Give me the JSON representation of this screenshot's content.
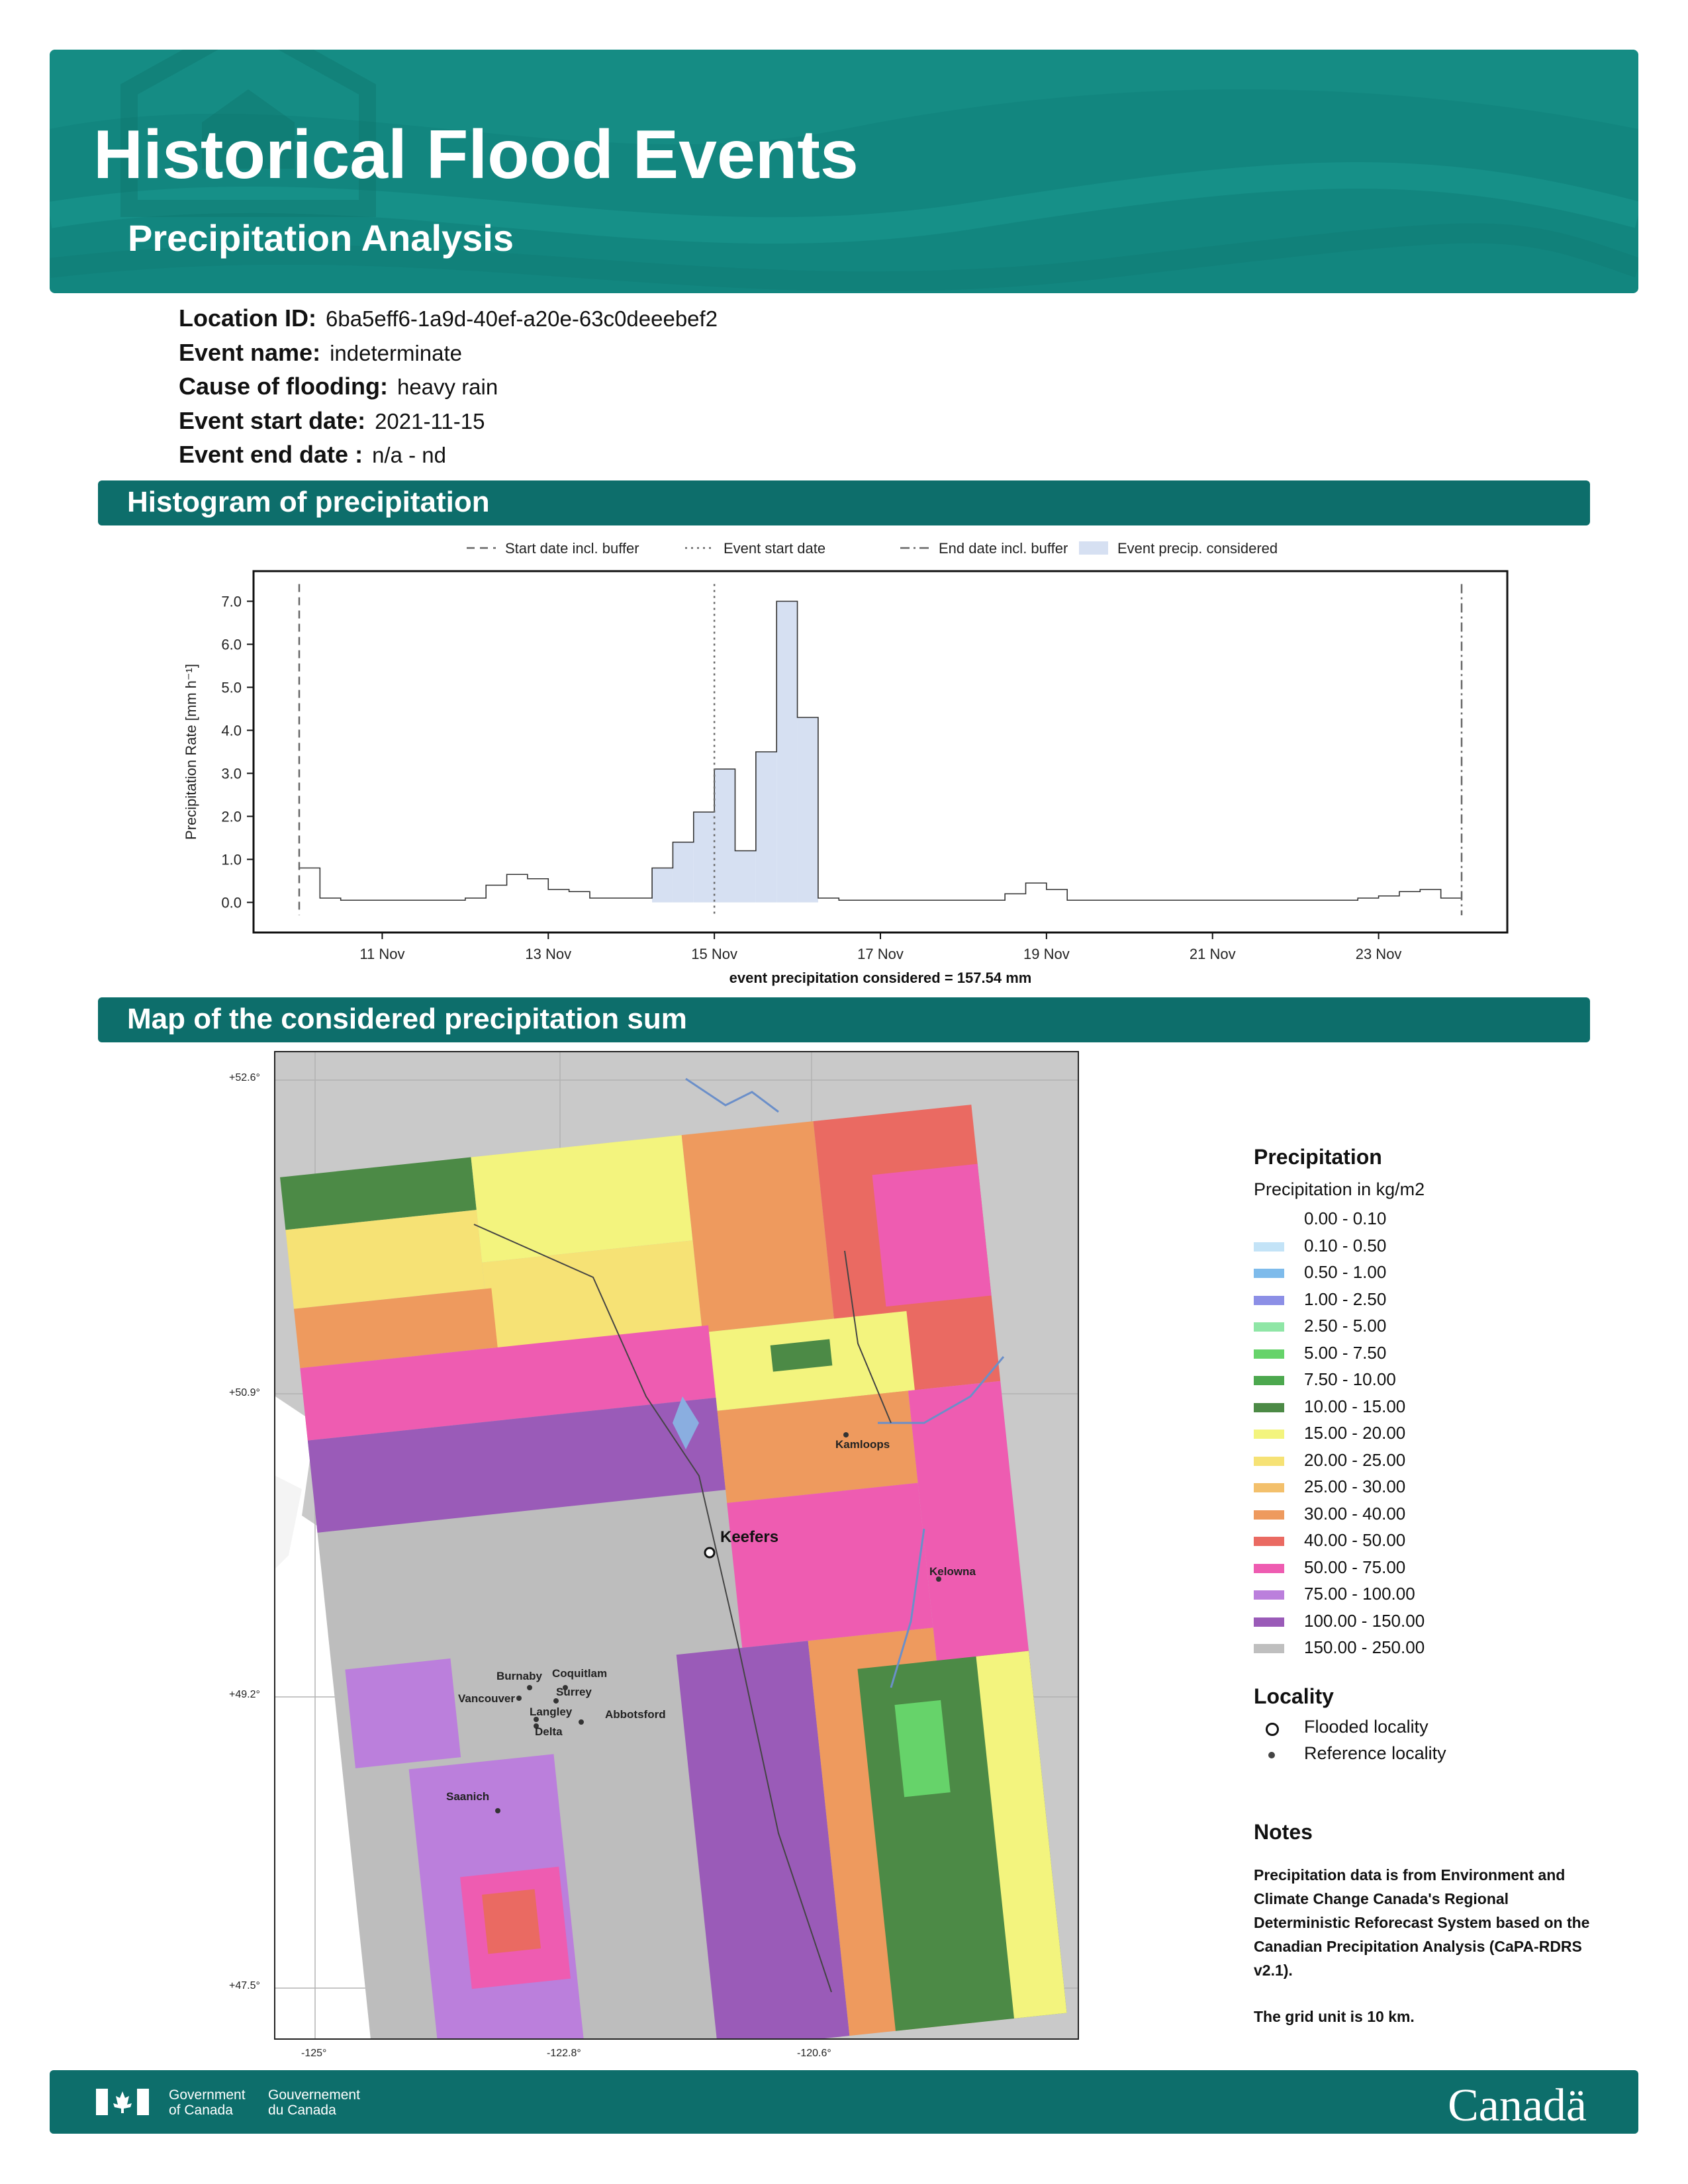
{
  "header": {
    "title": "Historical Flood Events",
    "subtitle": "Precipitation Analysis"
  },
  "event_info": [
    {
      "key": "Location ID:",
      "value": "6ba5eff6-1a9d-40ef-a20e-63c0deeebef2"
    },
    {
      "key": "Event name:",
      "value": "indeterminate"
    },
    {
      "key": "Cause of flooding:",
      "value": "heavy rain"
    },
    {
      "key": "Event start date:",
      "value": "2021-11-15"
    },
    {
      "key": "Event end date :",
      "value": "n/a - nd"
    }
  ],
  "sections": {
    "histogram": "Histogram of precipitation",
    "map": "Map of the considered precipitation sum"
  },
  "chart_data": {
    "type": "bar",
    "ylabel": "Precipitation Rate [mm h⁻¹]",
    "xlabel": "event precipitation considered = 157.54 mm",
    "ylim": [
      -0.7,
      7.7
    ],
    "yticks": [
      "0.0",
      "1.0",
      "2.0",
      "3.0",
      "4.0",
      "5.0",
      "6.0",
      "7.0"
    ],
    "xticks": [
      "11 Nov",
      "13 Nov",
      "15 Nov",
      "17 Nov",
      "19 Nov",
      "21 Nov",
      "23 Nov"
    ],
    "xtick_days": [
      11,
      13,
      15,
      17,
      19,
      21,
      23
    ],
    "x_start_day": 10,
    "bin_days": 0.25,
    "values": [
      0.8,
      0.1,
      0.05,
      0.05,
      0.05,
      0.05,
      0.05,
      0.05,
      0.1,
      0.4,
      0.65,
      0.55,
      0.3,
      0.25,
      0.1,
      0.1,
      0.1,
      0.8,
      1.4,
      2.1,
      3.1,
      1.2,
      3.5,
      7.0,
      4.3,
      0.1,
      0.05,
      0.05,
      0.05,
      0.05,
      0.05,
      0.05,
      0.05,
      0.05,
      0.2,
      0.45,
      0.3,
      0.05,
      0.05,
      0.05,
      0.05,
      0.05,
      0.05,
      0.05,
      0.05,
      0.05,
      0.05,
      0.05,
      0.05,
      0.05,
      0.05,
      0.1,
      0.15,
      0.25,
      0.3,
      0.1
    ],
    "event_considered_bins": [
      17,
      24
    ],
    "vlines": [
      {
        "day": 10.0,
        "style": "dashed",
        "name": "Start date incl. buffer"
      },
      {
        "day": 15.0,
        "style": "dotted",
        "name": "Event start date"
      },
      {
        "day": 24.0,
        "style": "dashdot",
        "name": "End date incl. buffer"
      }
    ],
    "legend": [
      {
        "style": "dashed",
        "name": "Start date incl. buffer"
      },
      {
        "style": "dotted",
        "name": "Event start date"
      },
      {
        "style": "dashdot",
        "name": "End date incl. buffer"
      },
      {
        "style": "patch",
        "name": "Event precip. considered",
        "color": "#d6e0f2"
      }
    ],
    "legend_position": "top-center",
    "grid": false
  },
  "map": {
    "lat_labels": [
      "+52.6°",
      "+50.9°",
      "+49.2°",
      "+47.5°"
    ],
    "lon_labels": [
      "-125°",
      "-122.8°",
      "-120.6°"
    ],
    "flooded_locality": "Keefers",
    "reference_localities": [
      "Kamloops",
      "Kelowna",
      "Burnaby",
      "Coquitlam",
      "Vancouver",
      "Surrey",
      "Langley",
      "Delta",
      "Abbotsford",
      "Saanich"
    ]
  },
  "legend": {
    "title": "Precipitation",
    "subtitle": "Precipitation in kg/m2",
    "classes": [
      {
        "label": "0.00 - 0.10",
        "color": "#ffffff"
      },
      {
        "label": "0.10 - 0.50",
        "color": "#c3e3f7"
      },
      {
        "label": "0.50 - 1.00",
        "color": "#7ebbeb"
      },
      {
        "label": "1.00 - 2.50",
        "color": "#8c8fe6"
      },
      {
        "label": "2.50 - 5.00",
        "color": "#8fe6a6"
      },
      {
        "label": "5.00 - 7.50",
        "color": "#66d36a"
      },
      {
        "label": "7.50 - 10.00",
        "color": "#4ca84e"
      },
      {
        "label": "10.00 - 15.00",
        "color": "#4c8a46"
      },
      {
        "label": "15.00 - 20.00",
        "color": "#f3f47e"
      },
      {
        "label": "20.00 - 25.00",
        "color": "#f6e275"
      },
      {
        "label": "25.00 - 30.00",
        "color": "#f3c06c"
      },
      {
        "label": "30.00 - 40.00",
        "color": "#ee9a5e"
      },
      {
        "label": "40.00 - 50.00",
        "color": "#ea6a62"
      },
      {
        "label": "50.00 - 75.00",
        "color": "#ee5cb1"
      },
      {
        "label": "75.00 - 100.00",
        "color": "#bb7fdc"
      },
      {
        "label": "100.00 - 150.00",
        "color": "#9a5bb8"
      },
      {
        "label": "150.00 - 250.00",
        "color": "#bfbfbf"
      }
    ],
    "locality_title": "Locality",
    "flooded_label": "Flooded locality",
    "reference_label": "Reference locality"
  },
  "notes": {
    "title": "Notes",
    "body": "Precipitation data is from Environment and Climate Change Canada's Regional Deterministic Reforecast System based on the Canadian Precipitation Analysis (CaPA-RDRS v2.1).",
    "grid_unit": "The grid unit is 10 km."
  },
  "footer": {
    "gov_en_1": "Government",
    "gov_en_2": "of Canada",
    "gov_fr_1": "Gouvernement",
    "gov_fr_2": "du Canada",
    "wordmark": "Canadä"
  },
  "colors": {
    "header": "#12867f",
    "section": "#0d6e6b",
    "bar_fill": "#d6e0f2"
  }
}
